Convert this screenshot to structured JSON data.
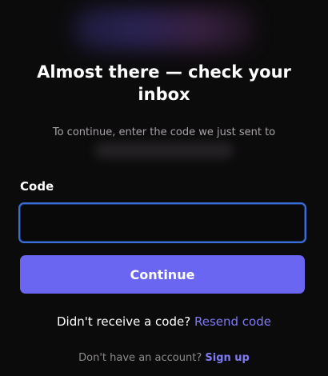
{
  "header": {
    "title": "Almost there — check your inbox",
    "subtitle": "To continue, enter the code we just sent to"
  },
  "form": {
    "code_label": "Code",
    "code_value": "",
    "continue_label": "Continue"
  },
  "resend": {
    "prompt": "Didn't receive a code?",
    "link_label": "Resend code"
  },
  "signup": {
    "prompt": "Don't have an account?",
    "link_label": "Sign up"
  },
  "colors": {
    "background": "#0c0b0c",
    "accent": "#6b66f2",
    "link": "#7f7af4",
    "input_focus_border": "#3a6ed8"
  }
}
